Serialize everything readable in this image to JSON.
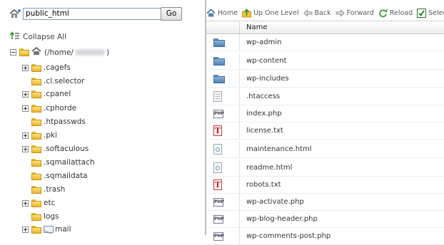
{
  "path_bar": {
    "value": "public_html",
    "go_label": "Go"
  },
  "tree": {
    "collapse_all": "Collapse All",
    "root_prefix": "(/home/",
    "root_suffix": ")",
    "items": [
      {
        "label": ".cagefs",
        "expandable": true
      },
      {
        "label": ".cl.selector",
        "expandable": false
      },
      {
        "label": ".cpanel",
        "expandable": true
      },
      {
        "label": ".cphorde",
        "expandable": true
      },
      {
        "label": ".htpasswds",
        "expandable": false
      },
      {
        "label": ".pki",
        "expandable": true
      },
      {
        "label": ".softaculous",
        "expandable": true
      },
      {
        "label": ".sqmailattach",
        "expandable": false
      },
      {
        "label": ".sqmaildata",
        "expandable": false
      },
      {
        "label": ".trash",
        "expandable": false
      },
      {
        "label": "etc",
        "expandable": true
      },
      {
        "label": "logs",
        "expandable": false
      },
      {
        "label": "mail",
        "expandable": true
      }
    ]
  },
  "toolbar": {
    "home": "Home",
    "up_one_level": "Up One Level",
    "back": "Back",
    "forward": "Forward",
    "reload": "Reload",
    "select_all": "Selec"
  },
  "file_list": {
    "column_name": "Name",
    "files": [
      {
        "name": "wp-admin",
        "icon": "folder"
      },
      {
        "name": "wp-content",
        "icon": "folder"
      },
      {
        "name": "wp-includes",
        "icon": "folder"
      },
      {
        "name": ".htaccess",
        "icon": "doc"
      },
      {
        "name": "index.php",
        "icon": "php"
      },
      {
        "name": "license.txt",
        "icon": "txt"
      },
      {
        "name": "maintenance.html",
        "icon": "html"
      },
      {
        "name": "readme.html",
        "icon": "html"
      },
      {
        "name": "robots.txt",
        "icon": "txt"
      },
      {
        "name": "wp-activate.php",
        "icon": "php"
      },
      {
        "name": "wp-blog-header.php",
        "icon": "php"
      },
      {
        "name": "wp-comments-post.php",
        "icon": "php"
      }
    ]
  }
}
